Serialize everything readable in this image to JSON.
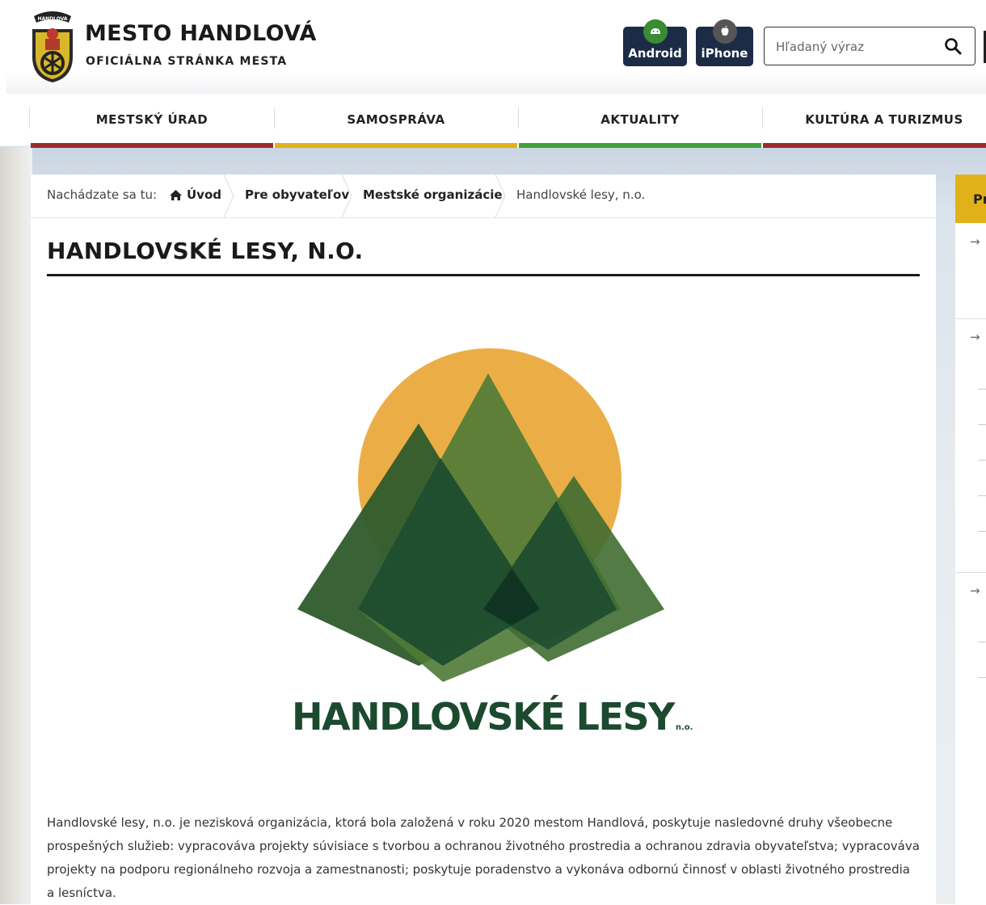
{
  "header": {
    "title": "MESTO HANDLOVÁ",
    "subtitle": "OFICIÁLNA STRÁNKA MESTA",
    "logo_text": "HANDLOVA",
    "apps": {
      "android": "Android",
      "iphone": "iPhone"
    },
    "search": {
      "placeholder": "Hľadaný výraz",
      "value": ""
    }
  },
  "nav": {
    "items": [
      {
        "label": "MESTSKÝ ÚRAD",
        "color": "#9b2b2e"
      },
      {
        "label": "SAMOSPRÁVA",
        "color": "#e1b11a"
      },
      {
        "label": "AKTUALITY",
        "color": "#3fa038"
      },
      {
        "label": "KULTÚRA A TURIZMUS",
        "color": "#9b2b2e"
      }
    ]
  },
  "breadcrumb": {
    "lead": "Nachádzate sa tu:",
    "items": [
      "Úvod",
      "Pre obyvateľov",
      "Mestské organizácie",
      "Handlovské lesy, n.o."
    ]
  },
  "main": {
    "title": "HANDLOVSKÉ LESY, N.O.",
    "image": {
      "name": "HANDLOVSKÉ LESY",
      "suffix": "n.o."
    },
    "body": "Handlovské lesy, n.o. je nezisková organizácia, ktorá bola založená v roku 2020 mestom Handlová, poskytuje nasledovné druhy všeobecne prospešných služieb: vypracováva projekty súvisiace s tvorbou a ochranou životného prostredia a ochranou zdravia obyvateľstva; vypracováva projekty na podporu regionálneho rozvoja a zamestnanosti; poskytuje poradenstvo a vykonáva odbornú činnosť v oblasti životného prostredia a lesníctva."
  },
  "sidebar": {
    "heading_partial": "Pr",
    "arrow": "→"
  },
  "colors": {
    "accent_yellow": "#e1b11a",
    "nav_red": "#9b2b2e",
    "nav_green": "#3fa038",
    "forest_dark": "#1b4a2f"
  }
}
